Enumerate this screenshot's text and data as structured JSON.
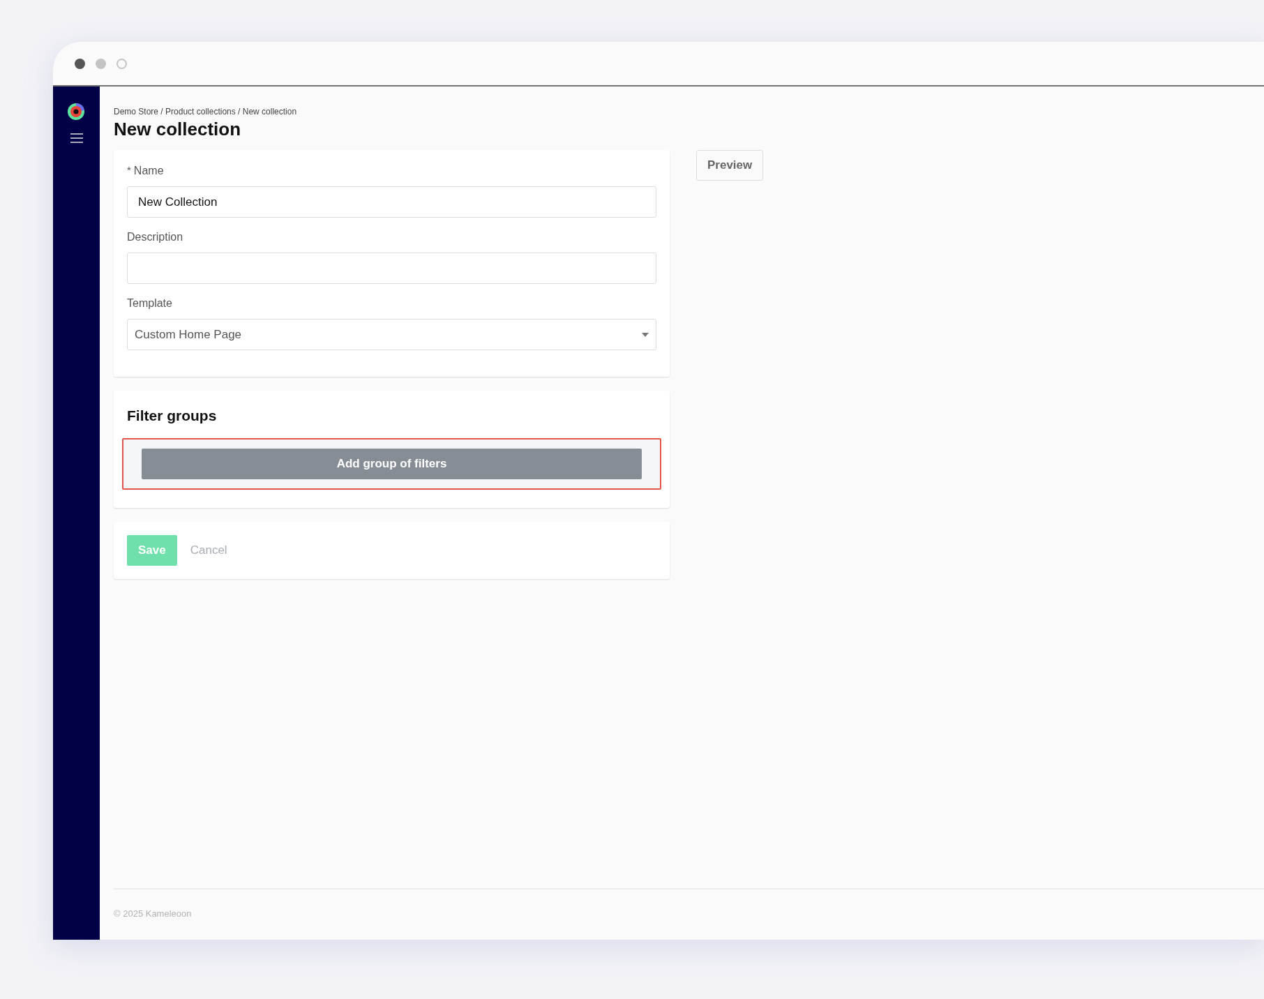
{
  "window": {
    "dots": [
      {
        "kind": "filled"
      },
      {
        "kind": "light"
      },
      {
        "kind": "ring"
      }
    ]
  },
  "breadcrumb": "Demo Store / Product collections / New collection",
  "title": "New collection",
  "preview_button": "Preview",
  "form": {
    "name": {
      "label": "Name",
      "required_mark": "*",
      "value": "New Collection"
    },
    "description": {
      "label": "Description"
    },
    "template": {
      "label": "Template",
      "value": "Custom Home Page"
    }
  },
  "filter_groups": {
    "title": "Filter groups",
    "add_button": "Add group of filters",
    "highlighted": true
  },
  "actions": {
    "save": "Save",
    "save_disabled": true,
    "cancel": "Cancel"
  },
  "footer": "© 2025 Kameleoon"
}
